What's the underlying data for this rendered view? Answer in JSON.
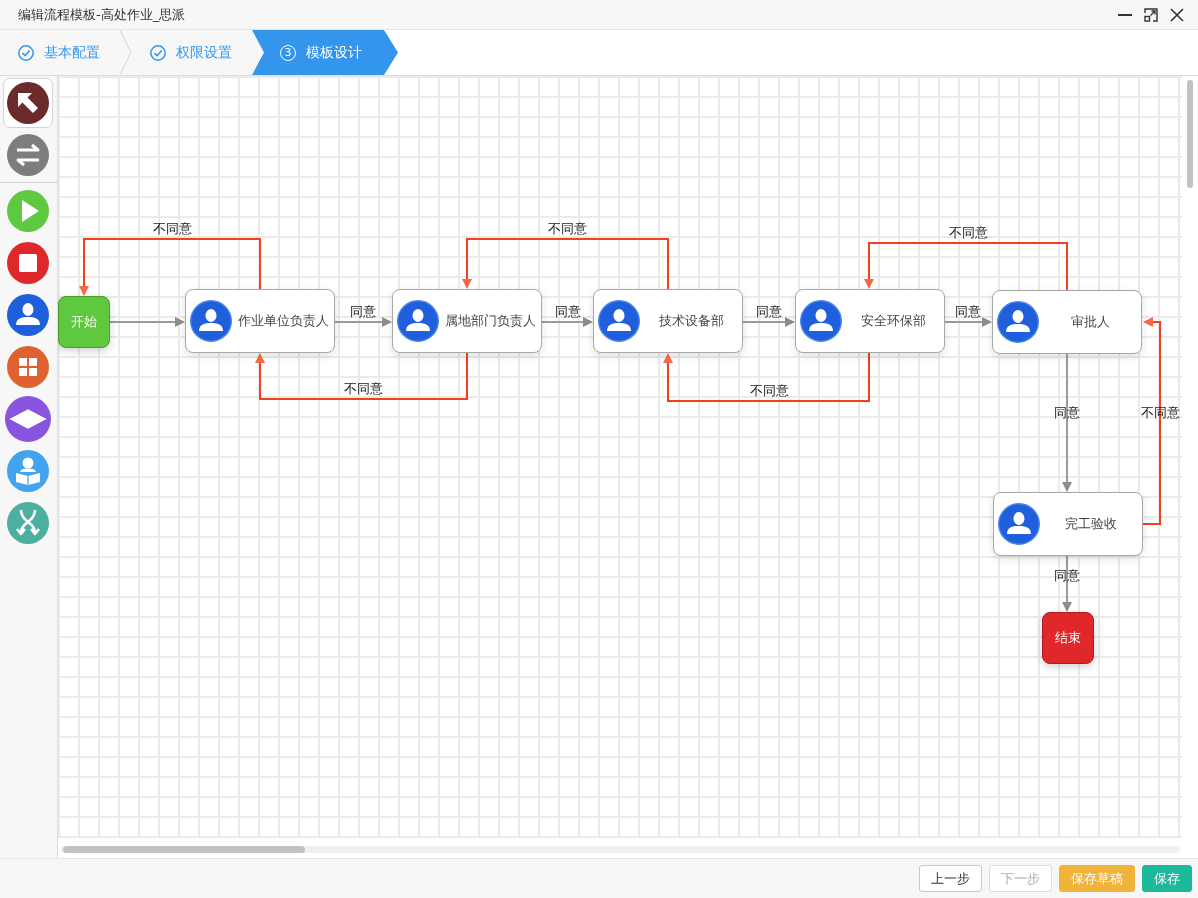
{
  "window": {
    "title": "编辑流程模板-高处作业_思派"
  },
  "steps": [
    {
      "label": "基本配置",
      "done": true,
      "selected": false
    },
    {
      "label": "权限设置",
      "done": true,
      "selected": false
    },
    {
      "label": "模板设计",
      "number": "3",
      "done": false,
      "selected": true
    }
  ],
  "toolbar": {
    "edit_tools": [
      {
        "kind": "select",
        "selected": true
      },
      {
        "kind": "connect",
        "selected": false
      }
    ],
    "node_tools": [
      {
        "kind": "start",
        "selected": false
      },
      {
        "kind": "end",
        "selected": false
      },
      {
        "kind": "task",
        "selected": false
      },
      {
        "kind": "group",
        "selected": false
      },
      {
        "kind": "decision",
        "selected": false
      },
      {
        "kind": "review",
        "selected": false
      },
      {
        "kind": "split",
        "selected": false
      }
    ]
  },
  "flow": {
    "nodes": [
      {
        "kind": "start",
        "label": "开始"
      },
      {
        "kind": "task",
        "label": "作业单位负责人"
      },
      {
        "kind": "task",
        "label": "属地部门负责人"
      },
      {
        "kind": "task",
        "label": "技术设备部"
      },
      {
        "kind": "task",
        "label": "安全环保部"
      },
      {
        "kind": "task",
        "label": "审批人"
      },
      {
        "kind": "task",
        "label": "完工验收"
      },
      {
        "kind": "end",
        "label": "结束"
      }
    ],
    "edges": [
      {
        "kind": "approve"
      },
      {
        "kind": "reject",
        "label": "不同意"
      },
      {
        "kind": "approve",
        "label": "同意"
      },
      {
        "kind": "reject",
        "label": "不同意"
      },
      {
        "kind": "approve",
        "label": "同意"
      },
      {
        "kind": "reject",
        "label": "不同意"
      },
      {
        "kind": "approve",
        "label": "同意"
      },
      {
        "kind": "reject",
        "label": "不同意"
      },
      {
        "kind": "approve",
        "label": "同意"
      },
      {
        "kind": "reject",
        "label": "不同意"
      },
      {
        "kind": "approve",
        "label": "同意"
      },
      {
        "kind": "reject",
        "label": "不同意"
      },
      {
        "kind": "approve",
        "label": "同意"
      }
    ]
  },
  "footer": {
    "buttons": [
      {
        "label": "上一步",
        "kind": "default",
        "disabled": false
      },
      {
        "label": "下一步",
        "kind": "default",
        "disabled": true
      },
      {
        "label": "保存草稿",
        "kind": "warning",
        "disabled": false
      },
      {
        "label": "保存",
        "kind": "primary",
        "disabled": false
      }
    ]
  }
}
